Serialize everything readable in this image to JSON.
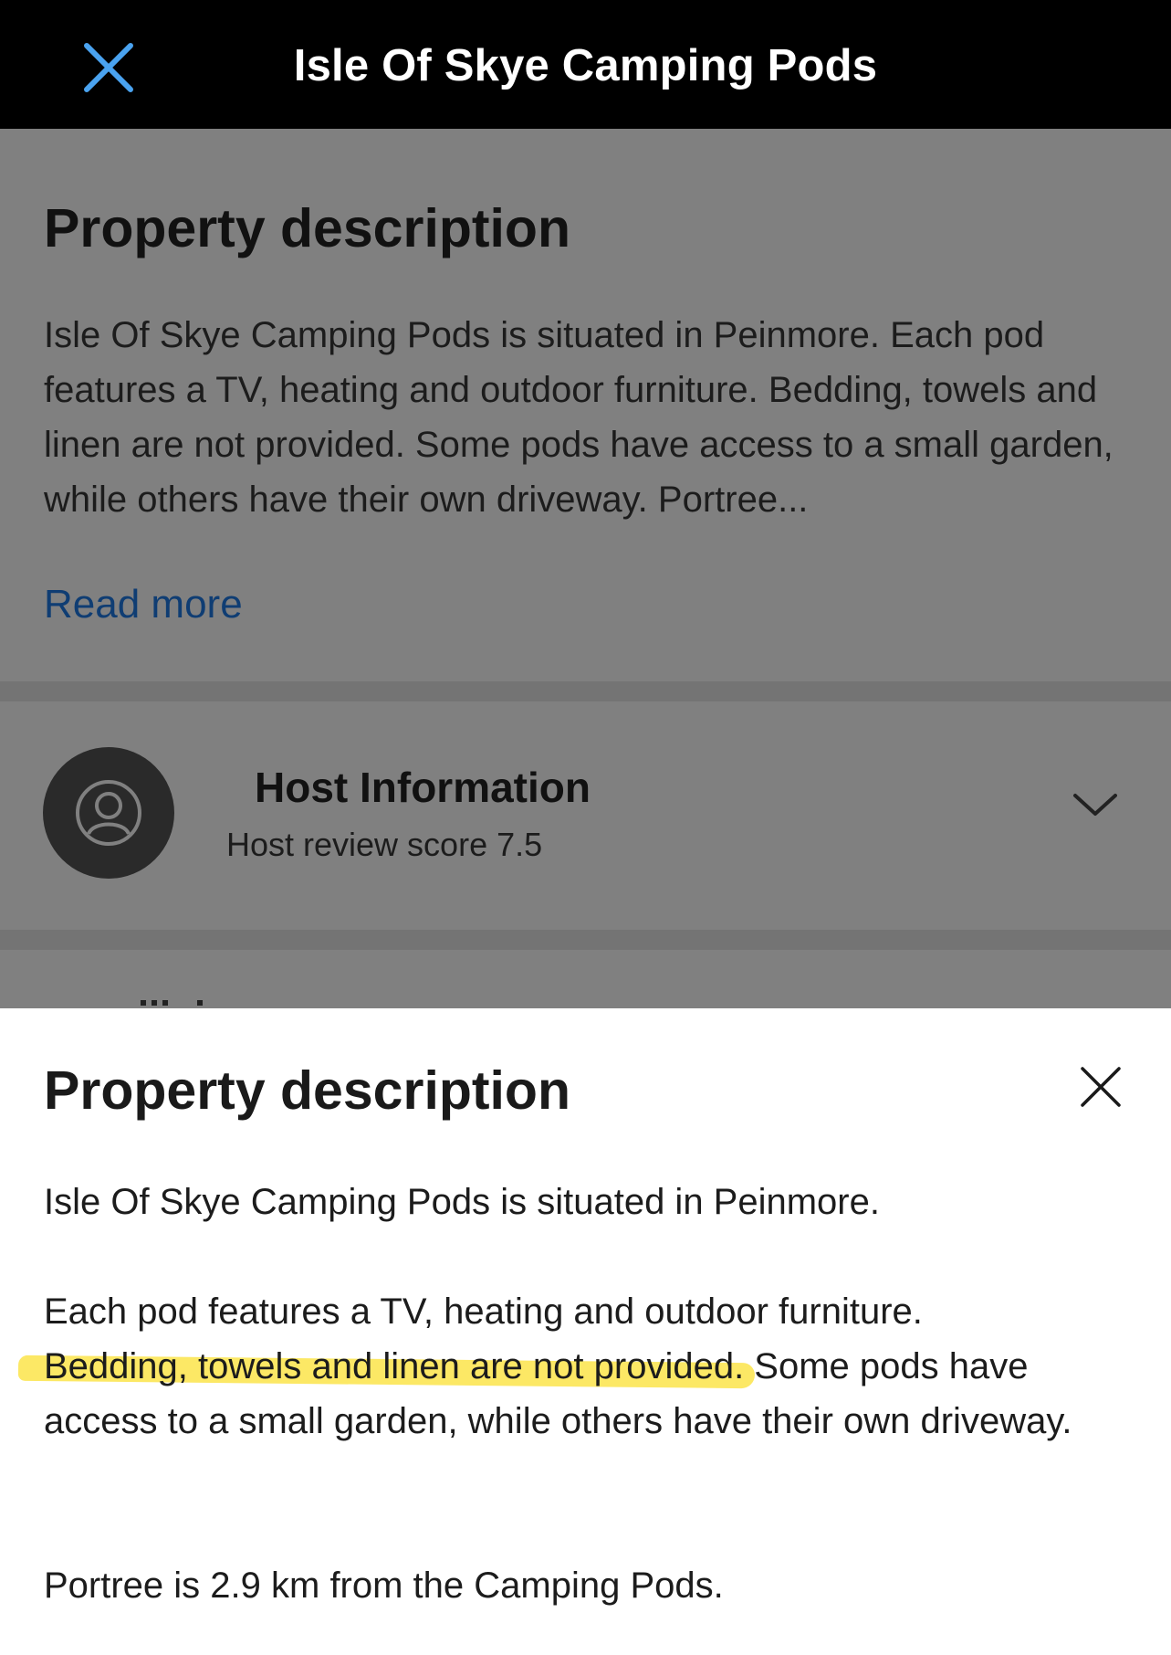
{
  "topbar": {
    "title": "Isle Of Skye Camping Pods"
  },
  "background": {
    "description_heading": "Property description",
    "description_preview": "Isle Of Skye Camping Pods is situated in Peinmore. Each pod features a TV, heating and outdoor furniture. Bedding, towels and linen are not provided. Some pods have access to a small garden, while others have their own driveway. Portree...",
    "read_more": "Read more",
    "host": {
      "title": "Host Information",
      "score_text": "Host review score 7.5"
    }
  },
  "sheet": {
    "title": "Property description",
    "paragraphs": {
      "p1": "Isle Of Skye Camping Pods is situated in Peinmore.",
      "p2_start": "Each pod features a TV, heating and outdoor furniture.",
      "p2_highlight": "Bedding, towels and linen are not provided.",
      "p2_end": " Some pods have access to a small garden, while others have their own driveway.",
      "p3": "Portree is 2.9 km from the Camping Pods."
    }
  },
  "colors": {
    "topbar_bg": "#000000",
    "close_icon": "#4aa3f0",
    "backdrop": "#808080",
    "link": "#0f3d73",
    "highlight": "#fbe44a"
  }
}
